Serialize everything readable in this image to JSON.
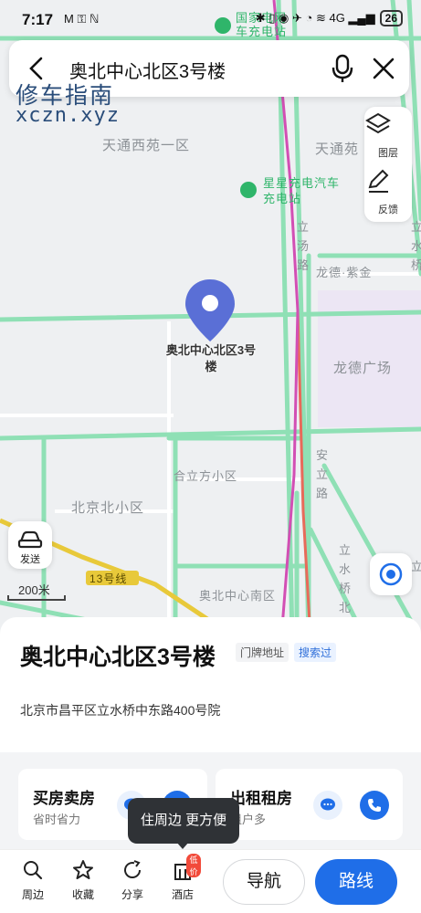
{
  "status": {
    "time": "7:17",
    "left_icons": "M ⚿ ℕ",
    "right_icons": "✱ ▯ ◉ ✈ ◔ ≋ 4G ▂▄▆",
    "battery": "26"
  },
  "search": {
    "query": "奥北中心北区3号楼"
  },
  "watermark": {
    "cn": "修车指南",
    "en": "xczn.xyz"
  },
  "tools": {
    "layers": "图层",
    "feedback": "反馈"
  },
  "map": {
    "labels": {
      "poi_top": "国家电网 车充电站",
      "tiantong_west": "天通西苑一区",
      "tiantong": "天通苑",
      "star_charge": "星星充电汽车充电站",
      "litang_road": "立汤路",
      "longde_zijin": "龙德·紫金",
      "longde_plaza": "龙德广场",
      "anli_road": "安立路",
      "helifang": "合立方小区",
      "beijingbei": "北京北小区",
      "shuiqiao_north": "立水桥北路",
      "line13": "13号线",
      "aobei_south": "奥北中心南区",
      "side_right_top": "立水桥",
      "side_right_bottom": "立"
    },
    "marker_label": "奥北中心北区3号楼",
    "send_label": "发送",
    "scale": "200米"
  },
  "place": {
    "title": "奥北中心北区3号楼",
    "tag_door": "门牌地址",
    "tag_searched": "搜索过",
    "address": "北京市昌平区立水桥中东路400号院"
  },
  "cards": [
    {
      "title": "买房卖房",
      "subtitle": "省时省力"
    },
    {
      "title": "出租租房",
      "subtitle": "租户多"
    }
  ],
  "tooltip": "住周边 更方便",
  "nav": {
    "nearby": "周边",
    "favorite": "收藏",
    "share": "分享",
    "hotel": "酒店",
    "hotel_badge": "低价",
    "navigate": "导航",
    "route": "路线"
  },
  "colors": {
    "accent": "#1f6ee8",
    "road_green": "#8fe0b5",
    "marker": "#5a6fd6",
    "metro_yellow": "#e8c93a",
    "purple_area": "#ece6f4"
  }
}
